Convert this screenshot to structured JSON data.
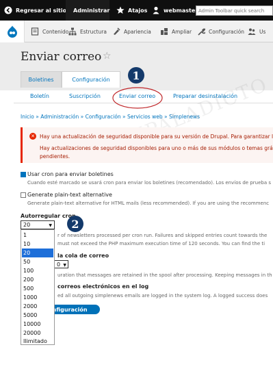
{
  "toolbar": {
    "back_label": "Regresar al sitio",
    "manage_label": "Administrar",
    "shortcuts_label": "Atajos",
    "user_label": "webmaster",
    "search_placeholder": "Admin Toolbar quick search"
  },
  "tray": {
    "items": [
      {
        "label": "Contenido",
        "icon": "content-icon"
      },
      {
        "label": "Estructura",
        "icon": "structure-icon"
      },
      {
        "label": "Apariencia",
        "icon": "appearance-icon"
      },
      {
        "label": "Ampliar",
        "icon": "extend-icon"
      },
      {
        "label": "Configuración",
        "icon": "wrench-icon"
      },
      {
        "label": "Us",
        "icon": "people-icon"
      }
    ]
  },
  "page": {
    "title": "Enviar correo",
    "primary_tabs": [
      "Boletines",
      "Configuración"
    ],
    "secondary_tabs": [
      "Boletín",
      "Suscripción",
      "Enviar correo",
      "Preparar desinstalación"
    ],
    "breadcrumb": "Inicio » Administración » Configuración » Servicios web » Simplenews",
    "watermark": "RUPALADICTO"
  },
  "alert": {
    "line1": "Hay una actualización de seguridad disponible para su versión de Drupal. Para garantizar la",
    "line2": "Hay actualizaciones de seguridad disponibles para uno o más de sus módulos o temas gráf",
    "line3": "pendientes."
  },
  "form": {
    "use_cron_label": "Usar cron para enviar boletines",
    "use_cron_desc": "Cuando esté marcado se usará cron para enviar los boletines (recomendado). Los envíos de prueba s",
    "plain_label": "Generate plain-text alternative",
    "plain_desc": "Generate plain-text alternative for HTML mails (less recommended). If you are using the recommenc",
    "throttle_label": "Autorregular cron",
    "throttle_value": "20",
    "throttle_desc1": "r of newsletters processed per cron run. Failures and skipped entries count towards the",
    "throttle_desc2": "must not exceed the PHP maximum execution time of 120 seconds. You can find the ti",
    "spool_label": "la cola de correo",
    "spool_value": "0",
    "spool_desc": "uration that messages are retained in the spool after processing. Keeping messages in th",
    "log_label": "correos electrónicos en el log",
    "log_desc": "ed all outgoing simplenews emails are logged in the system log. A logged success does",
    "save_label": "onfiguración",
    "options": [
      "1",
      "10",
      "20",
      "50",
      "100",
      "200",
      "500",
      "1000",
      "2000",
      "5000",
      "10000",
      "20000",
      "Ilimitado"
    ],
    "selected_option": "20"
  },
  "badges": [
    "1",
    "2"
  ],
  "colors": {
    "accent": "#0074bd",
    "error": "#e62600",
    "selected": "#1e6fd9",
    "badge": "#143a6b"
  }
}
